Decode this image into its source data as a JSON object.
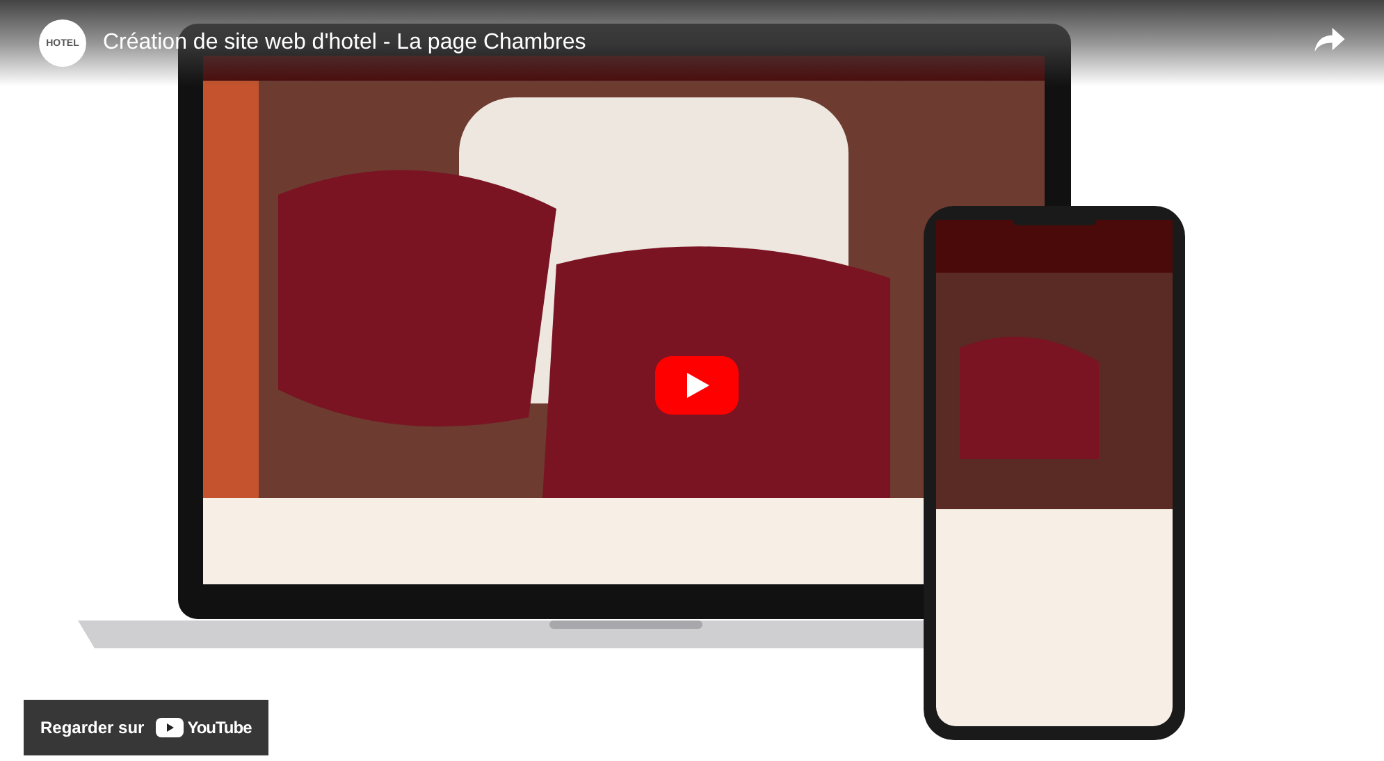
{
  "player": {
    "title": "Création de site web d'hotel - La page Chambres",
    "channel_avatar": "HOTEL",
    "watch_on": {
      "label": "Regarder sur",
      "brand": "YouTube"
    }
  }
}
